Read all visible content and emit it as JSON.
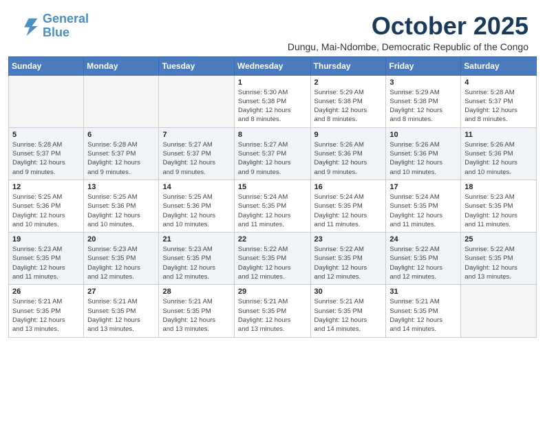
{
  "header": {
    "logo_line1": "General",
    "logo_line2": "Blue",
    "month": "October 2025",
    "location": "Dungu, Mai-Ndombe, Democratic Republic of the Congo"
  },
  "weekdays": [
    "Sunday",
    "Monday",
    "Tuesday",
    "Wednesday",
    "Thursday",
    "Friday",
    "Saturday"
  ],
  "weeks": [
    [
      {
        "day": "",
        "info": ""
      },
      {
        "day": "",
        "info": ""
      },
      {
        "day": "",
        "info": ""
      },
      {
        "day": "1",
        "info": "Sunrise: 5:30 AM\nSunset: 5:38 PM\nDaylight: 12 hours\nand 8 minutes."
      },
      {
        "day": "2",
        "info": "Sunrise: 5:29 AM\nSunset: 5:38 PM\nDaylight: 12 hours\nand 8 minutes."
      },
      {
        "day": "3",
        "info": "Sunrise: 5:29 AM\nSunset: 5:38 PM\nDaylight: 12 hours\nand 8 minutes."
      },
      {
        "day": "4",
        "info": "Sunrise: 5:28 AM\nSunset: 5:37 PM\nDaylight: 12 hours\nand 8 minutes."
      }
    ],
    [
      {
        "day": "5",
        "info": "Sunrise: 5:28 AM\nSunset: 5:37 PM\nDaylight: 12 hours\nand 9 minutes."
      },
      {
        "day": "6",
        "info": "Sunrise: 5:28 AM\nSunset: 5:37 PM\nDaylight: 12 hours\nand 9 minutes."
      },
      {
        "day": "7",
        "info": "Sunrise: 5:27 AM\nSunset: 5:37 PM\nDaylight: 12 hours\nand 9 minutes."
      },
      {
        "day": "8",
        "info": "Sunrise: 5:27 AM\nSunset: 5:37 PM\nDaylight: 12 hours\nand 9 minutes."
      },
      {
        "day": "9",
        "info": "Sunrise: 5:26 AM\nSunset: 5:36 PM\nDaylight: 12 hours\nand 9 minutes."
      },
      {
        "day": "10",
        "info": "Sunrise: 5:26 AM\nSunset: 5:36 PM\nDaylight: 12 hours\nand 10 minutes."
      },
      {
        "day": "11",
        "info": "Sunrise: 5:26 AM\nSunset: 5:36 PM\nDaylight: 12 hours\nand 10 minutes."
      }
    ],
    [
      {
        "day": "12",
        "info": "Sunrise: 5:25 AM\nSunset: 5:36 PM\nDaylight: 12 hours\nand 10 minutes."
      },
      {
        "day": "13",
        "info": "Sunrise: 5:25 AM\nSunset: 5:36 PM\nDaylight: 12 hours\nand 10 minutes."
      },
      {
        "day": "14",
        "info": "Sunrise: 5:25 AM\nSunset: 5:36 PM\nDaylight: 12 hours\nand 10 minutes."
      },
      {
        "day": "15",
        "info": "Sunrise: 5:24 AM\nSunset: 5:35 PM\nDaylight: 12 hours\nand 11 minutes."
      },
      {
        "day": "16",
        "info": "Sunrise: 5:24 AM\nSunset: 5:35 PM\nDaylight: 12 hours\nand 11 minutes."
      },
      {
        "day": "17",
        "info": "Sunrise: 5:24 AM\nSunset: 5:35 PM\nDaylight: 12 hours\nand 11 minutes."
      },
      {
        "day": "18",
        "info": "Sunrise: 5:23 AM\nSunset: 5:35 PM\nDaylight: 12 hours\nand 11 minutes."
      }
    ],
    [
      {
        "day": "19",
        "info": "Sunrise: 5:23 AM\nSunset: 5:35 PM\nDaylight: 12 hours\nand 11 minutes."
      },
      {
        "day": "20",
        "info": "Sunrise: 5:23 AM\nSunset: 5:35 PM\nDaylight: 12 hours\nand 12 minutes."
      },
      {
        "day": "21",
        "info": "Sunrise: 5:23 AM\nSunset: 5:35 PM\nDaylight: 12 hours\nand 12 minutes."
      },
      {
        "day": "22",
        "info": "Sunrise: 5:22 AM\nSunset: 5:35 PM\nDaylight: 12 hours\nand 12 minutes."
      },
      {
        "day": "23",
        "info": "Sunrise: 5:22 AM\nSunset: 5:35 PM\nDaylight: 12 hours\nand 12 minutes."
      },
      {
        "day": "24",
        "info": "Sunrise: 5:22 AM\nSunset: 5:35 PM\nDaylight: 12 hours\nand 12 minutes."
      },
      {
        "day": "25",
        "info": "Sunrise: 5:22 AM\nSunset: 5:35 PM\nDaylight: 12 hours\nand 13 minutes."
      }
    ],
    [
      {
        "day": "26",
        "info": "Sunrise: 5:21 AM\nSunset: 5:35 PM\nDaylight: 12 hours\nand 13 minutes."
      },
      {
        "day": "27",
        "info": "Sunrise: 5:21 AM\nSunset: 5:35 PM\nDaylight: 12 hours\nand 13 minutes."
      },
      {
        "day": "28",
        "info": "Sunrise: 5:21 AM\nSunset: 5:35 PM\nDaylight: 12 hours\nand 13 minutes."
      },
      {
        "day": "29",
        "info": "Sunrise: 5:21 AM\nSunset: 5:35 PM\nDaylight: 12 hours\nand 13 minutes."
      },
      {
        "day": "30",
        "info": "Sunrise: 5:21 AM\nSunset: 5:35 PM\nDaylight: 12 hours\nand 14 minutes."
      },
      {
        "day": "31",
        "info": "Sunrise: 5:21 AM\nSunset: 5:35 PM\nDaylight: 12 hours\nand 14 minutes."
      },
      {
        "day": "",
        "info": ""
      }
    ]
  ]
}
